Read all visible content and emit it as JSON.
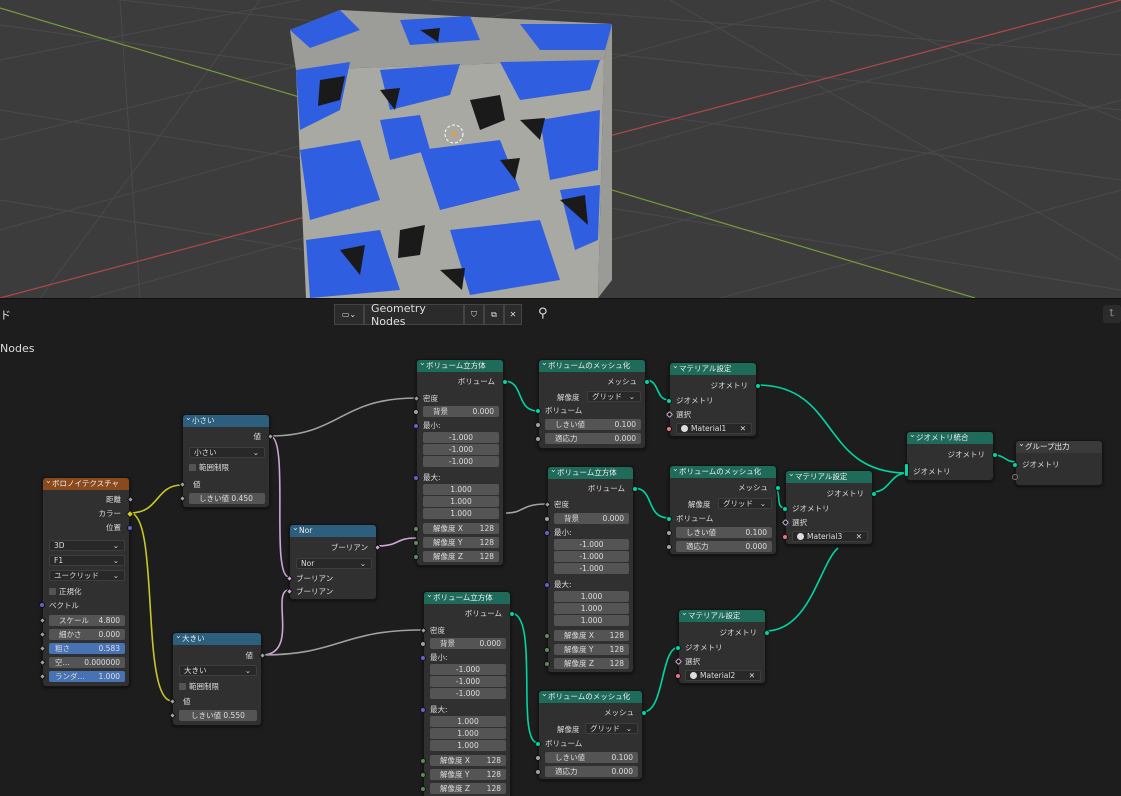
{
  "header": {
    "editor_label_partial": "ド",
    "tree_name": "Geometry Nodes",
    "breadcrumb": "Nodes"
  },
  "nodes": {
    "voronoi": {
      "title": "ボロノイテクスチャ",
      "out_distance": "距離",
      "out_color": "カラー",
      "out_position": "位置",
      "dim": "3D",
      "feature": "F1",
      "metric": "ユークリッド",
      "normalize": "正規化",
      "vector": "ベクトル",
      "scale_label": "スケール",
      "scale": "4.800",
      "detail_label": "細かさ",
      "detail": "0.000",
      "roughness_label": "粗さ",
      "roughness": "0.583",
      "lacunarity_label": "空...",
      "lacunarity": "0.000000",
      "random_label": "ランダ...",
      "random": "1.000"
    },
    "compare_small": {
      "title": "小さい",
      "out_value": "値",
      "mode": "小さい",
      "clamp": "範囲制限",
      "in_value": "値",
      "threshold_label": "しきい値",
      "threshold": "0.450"
    },
    "compare_large": {
      "title": "大きい",
      "out_value": "値",
      "mode": "大きい",
      "clamp": "範囲制限",
      "in_value": "値",
      "threshold_label": "しきい値",
      "threshold": "0.550"
    },
    "nor": {
      "title": "Nor",
      "out_bool": "ブーリアン",
      "mode": "Nor",
      "in1": "ブーリアン",
      "in2": "ブーリアン"
    },
    "vol_cube_1": {
      "title": "ボリューム立方体",
      "out": "ボリューム",
      "density": "密度",
      "background_label": "背景",
      "background": "0.000",
      "min": "最小:",
      "min_vals": [
        "-1.000",
        "-1.000",
        "-1.000"
      ],
      "max": "最大:",
      "max_vals": [
        "1.000",
        "1.000",
        "1.000"
      ],
      "res_x_label": "解像度 X",
      "res_x": "128",
      "res_y_label": "解像度 Y",
      "res_y": "128",
      "res_z_label": "解像度 Z",
      "res_z": "128"
    },
    "vol_cube_2": {
      "title": "ボリューム立方体",
      "out": "ボリューム",
      "density": "密度",
      "background_label": "背景",
      "background": "0.000",
      "min": "最小:",
      "min_vals": [
        "-1.000",
        "-1.000",
        "-1.000"
      ],
      "max": "最大:",
      "max_vals": [
        "1.000",
        "1.000",
        "1.000"
      ],
      "res_x_label": "解像度 X",
      "res_x": "128",
      "res_y_label": "解像度 Y",
      "res_y": "128",
      "res_z_label": "解像度 Z",
      "res_z": "128"
    },
    "vol_cube_3": {
      "title": "ボリューム立方体",
      "out": "ボリューム",
      "density": "密度",
      "background_label": "背景",
      "background": "0.000",
      "min": "最小:",
      "min_vals": [
        "-1.000",
        "-1.000",
        "-1.000"
      ],
      "max": "最大:",
      "max_vals": [
        "1.000",
        "1.000",
        "1.000"
      ],
      "res_x_label": "解像度 X",
      "res_x": "128",
      "res_y_label": "解像度 Y",
      "res_y": "128",
      "res_z_label": "解像度 Z",
      "res_z": "128"
    },
    "v2m_1": {
      "title": "ボリュームのメッシュ化",
      "out": "メッシュ",
      "res_label": "解像度",
      "res_mode": "グリッド",
      "in_volume": "ボリューム",
      "threshold_label": "しきい値",
      "threshold": "0.100",
      "adapt_label": "適応力",
      "adapt": "0.000"
    },
    "v2m_2": {
      "title": "ボリュームのメッシュ化",
      "out": "メッシュ",
      "res_label": "解像度",
      "res_mode": "グリッド",
      "in_volume": "ボリューム",
      "threshold_label": "しきい値",
      "threshold": "0.100",
      "adapt_label": "適応力",
      "adapt": "0.000"
    },
    "v2m_3": {
      "title": "ボリュームのメッシュ化",
      "out": "メッシュ",
      "res_label": "解像度",
      "res_mode": "グリッド",
      "in_volume": "ボリューム",
      "threshold_label": "しきい値",
      "threshold": "0.100",
      "adapt_label": "適応力",
      "adapt": "0.000"
    },
    "setmat_1": {
      "title": "マテリアル設定",
      "out": "ジオメトリ",
      "in_geo": "ジオメトリ",
      "selection": "選択",
      "material": "Material1"
    },
    "setmat_2": {
      "title": "マテリアル設定",
      "out": "ジオメトリ",
      "in_geo": "ジオメトリ",
      "selection": "選択",
      "material": "Material2"
    },
    "setmat_3": {
      "title": "マテリアル設定",
      "out": "ジオメトリ",
      "in_geo": "ジオメトリ",
      "selection": "選択",
      "material": "Material3"
    },
    "join": {
      "title": "ジオメトリ統合",
      "out": "ジオメトリ",
      "in_geo": "ジオメトリ"
    },
    "group_out": {
      "title": "グループ出力",
      "in_geo": "ジオメトリ"
    }
  },
  "colors": {
    "geometry_header": "#1f6b5a",
    "texture_header": "#8a4a1d",
    "utility_header": "#2b5f7d",
    "geometry_socket": "#00d6a3",
    "link": "#00d6a3"
  }
}
